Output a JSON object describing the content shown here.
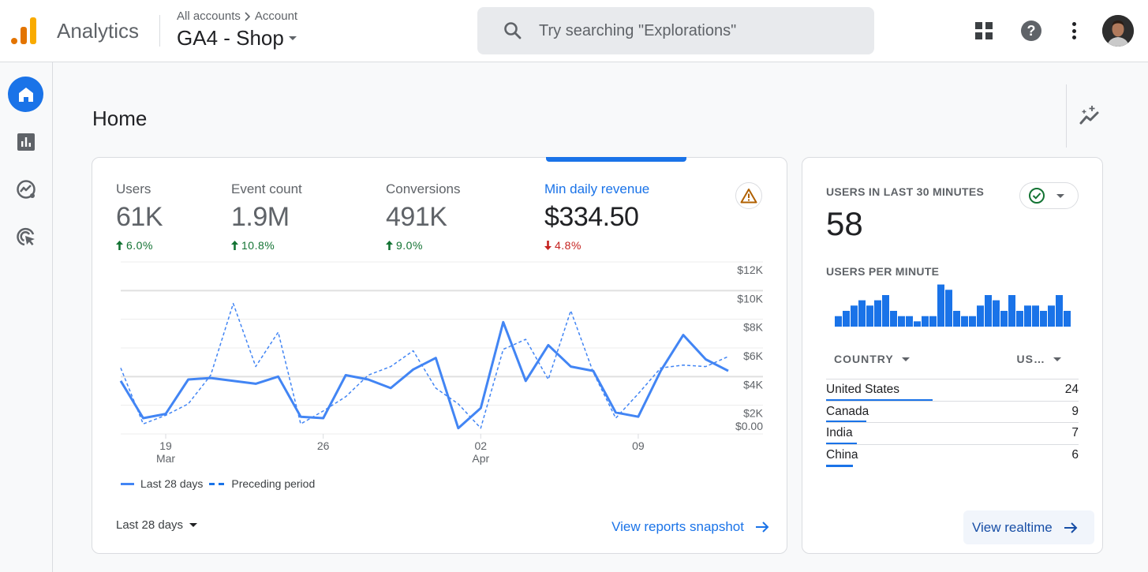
{
  "header": {
    "app_name": "Analytics",
    "breadcrumb": [
      "All accounts",
      "Account"
    ],
    "property": "GA4 - Shop",
    "search_placeholder": "Try searching \"Explorations\""
  },
  "icons": {
    "logo": "analytics-logo-icon",
    "apps": "apps-grid-icon",
    "help": "help-icon",
    "more": "more-vert-icon",
    "avatar": "user-avatar",
    "nav": [
      "home-icon",
      "reports-icon",
      "explore-icon",
      "advertising-icon"
    ],
    "insights": "insights-icon"
  },
  "colors": {
    "accent": "#1a73e8",
    "line": "#4285f4",
    "up": "#137333",
    "down": "#c5221f",
    "warning": "#b06000"
  },
  "page": {
    "title": "Home"
  },
  "summary": {
    "metrics": [
      {
        "label": "Users",
        "value": "61K",
        "change": "6.0%",
        "direction": "up"
      },
      {
        "label": "Event count",
        "value": "1.9M",
        "change": "10.8%",
        "direction": "up"
      },
      {
        "label": "Conversions",
        "value": "491K",
        "change": "9.0%",
        "direction": "up"
      },
      {
        "label": "Min daily revenue",
        "value": "$334.50",
        "change": "4.8%",
        "direction": "down",
        "active": true
      }
    ],
    "legend": {
      "current": "Last 28 days",
      "previous": "Preceding period"
    },
    "date_range": "Last 28 days",
    "view_link": "View reports snapshot"
  },
  "chart_data": {
    "type": "line",
    "title": "Min daily revenue",
    "xlabel": "",
    "ylabel": "",
    "ylim": [
      0,
      12
    ],
    "y_unit": "$K",
    "y_ticks": [
      "$0.00",
      "$2K",
      "$4K",
      "$6K",
      "$8K",
      "$10K",
      "$12K"
    ],
    "y_tick_values": [
      0,
      2,
      4,
      6,
      8,
      10,
      12
    ],
    "x_ticks": [
      {
        "index": 2,
        "label": "19",
        "sublabel": "Mar"
      },
      {
        "index": 9,
        "label": "26",
        "sublabel": ""
      },
      {
        "index": 16,
        "label": "02",
        "sublabel": "Apr"
      },
      {
        "index": 23,
        "label": "09",
        "sublabel": ""
      }
    ],
    "grid": true,
    "legend_position": "bottom-left",
    "series": [
      {
        "name": "Last 28 days",
        "style": "solid",
        "values": [
          3.7,
          1.1,
          1.4,
          3.8,
          3.9,
          3.7,
          3.5,
          4.0,
          1.2,
          1.1,
          4.1,
          3.8,
          3.2,
          4.5,
          5.3,
          0.4,
          1.8,
          7.8,
          3.7,
          6.2,
          4.7,
          4.4,
          1.5,
          1.2,
          4.4,
          6.9,
          5.2,
          4.4
        ]
      },
      {
        "name": "Preceding period",
        "style": "dashed",
        "values": [
          4.6,
          0.7,
          1.3,
          2.1,
          4.1,
          9.1,
          4.7,
          7.1,
          0.7,
          1.6,
          2.6,
          4.1,
          4.7,
          5.8,
          3.2,
          2.1,
          0.4,
          5.9,
          6.6,
          3.8,
          8.6,
          4.3,
          1.1,
          2.8,
          4.6,
          4.8,
          4.7,
          5.4
        ]
      }
    ]
  },
  "realtime": {
    "title": "USERS IN LAST 30 MINUTES",
    "value": "58",
    "per_minute_label": "USERS PER MINUTE",
    "per_minute": [
      2,
      3,
      4,
      5,
      4,
      5,
      6,
      3,
      2,
      2,
      1,
      2,
      2,
      8,
      7,
      3,
      2,
      2,
      4,
      6,
      5,
      3,
      6,
      3,
      4,
      4,
      3,
      4,
      6,
      3
    ],
    "table_headers": {
      "dimension": "COUNTRY",
      "metric": "US…"
    },
    "rows": [
      {
        "country": "United States",
        "users": "24",
        "share": 1.0
      },
      {
        "country": "Canada",
        "users": "9",
        "share": 0.375
      },
      {
        "country": "India",
        "users": "7",
        "share": 0.29
      },
      {
        "country": "China",
        "users": "6",
        "share": 0.25
      }
    ],
    "view_link": "View realtime"
  }
}
